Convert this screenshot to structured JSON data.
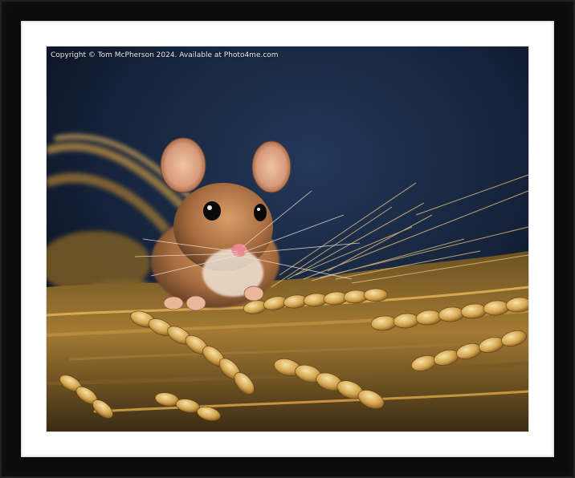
{
  "artwork": {
    "copyright": "Copyright © Tom McPherson 2024. Available at Photo4me.com",
    "subject": "mouse-on-wheat"
  },
  "colors": {
    "frame": "#0b0b0b",
    "mount": "#ffffff",
    "backdrop": "#1a2942",
    "wheat": "#c99a3f",
    "fur": "#b67a4a"
  }
}
